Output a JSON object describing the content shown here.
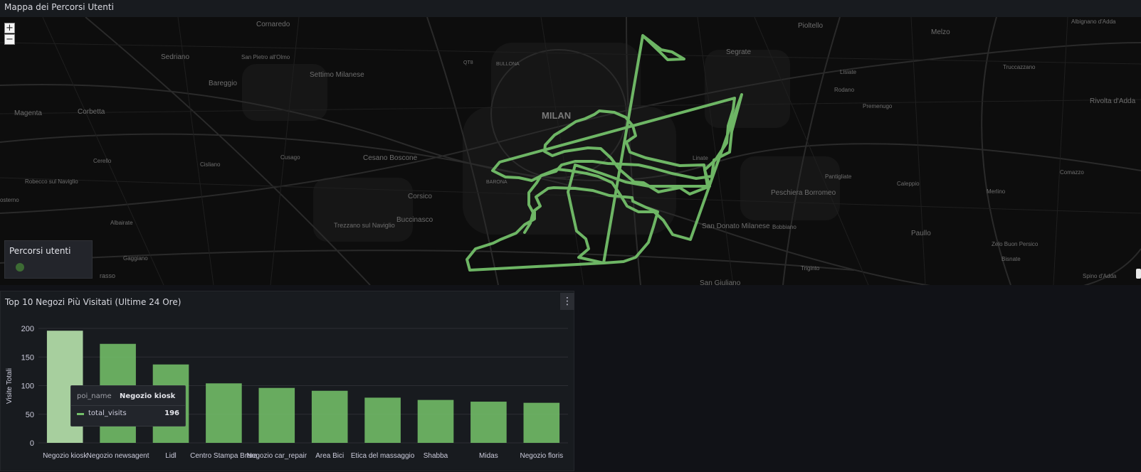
{
  "map_panel": {
    "title": "Mappa dei Percorsi Utenti",
    "zoom_in": "+",
    "zoom_out": "−",
    "legend_title": "Percorsi utenti",
    "route_color": "#73bf69",
    "place_labels": {
      "cornaredo": "Cornaredo",
      "pioltello": "Pioltello",
      "melzo": "Melzo",
      "albignano": "Albignano d'Adda",
      "sedriano": "Sedriano",
      "san_pietro": "San Pietro all'Olmo",
      "settimo": "Settimo Milanese",
      "segrate": "Segrate",
      "bareggio": "Bareggio",
      "bullona": "BULLONA",
      "qt8": "QT8",
      "rodano": "Rodano",
      "truccazzano": "Truccazzano",
      "magenta": "Magenta",
      "corbetta": "Corbetta",
      "milan": "MILAN",
      "pioltello_label": "Pioltello",
      "premenugo": "Premenugo",
      "rivolta": "Rivolta d'Adda",
      "cusago": "Cusago",
      "cesano": "Cesano Boscone",
      "cisliano": "Cisliano",
      "cerello": "Cerello",
      "robecco": "Robecco sul Naviglio",
      "corsico": "Corsico",
      "buccinasco": "Buccinasco",
      "albairate": "Albairate",
      "trezzano": "Trezzano sul Naviglio",
      "gaggiano": "Gaggiano",
      "pantigliate": "Pantigliate",
      "caleppio": "Caleppio",
      "peschiera": "Peschiera Borromeo",
      "merlino": "Merlino",
      "comazzo": "Comazzo",
      "bobbiano": "Bobbiano",
      "paullo": "Paullo",
      "zelo": "Zelo Buon Persico",
      "san_donato": "San Donato Milanese",
      "san_giuliano": "San Giuliano",
      "triginto": "Triginto",
      "bisnate": "Bisnate",
      "spino": "Spino d'Adda",
      "lisiate": "Lisiate",
      "barona": "BARONA",
      "linate": "Linate",
      "osterno": "osterno",
      "grasso": "rasso"
    }
  },
  "chart_panel": {
    "title": "Top 10 Negozi Più Visitati (Ultime 24 Ore)",
    "menu_icon": "⋮",
    "tooltip": {
      "key_label": "poi_name",
      "key_value": "Negozio kiosk",
      "series_label": "total_visits",
      "series_value": "196"
    }
  },
  "chart_data": {
    "type": "bar",
    "title": "Top 10 Negozi Più Visitati (Ultime 24 Ore)",
    "xlabel": "",
    "ylabel": "Visite Totali",
    "categories": [
      "Negozio kiosk",
      "Negozio newsagent",
      "Lidl",
      "Centro Stampa Brera",
      "Negozio car_repair",
      "Area Bici",
      "Etica del massaggio",
      "Shabba",
      "Midas",
      "Negozio florist"
    ],
    "category_labels": [
      "Negozio kiosk",
      "Negozio newsagent",
      "Lidl",
      "Centro Stampa Brera",
      "Negozio car_repair",
      "Area Bici",
      "Etica del massaggio",
      "Shabba",
      "Midas",
      "Negozio floris"
    ],
    "series": [
      {
        "name": "total_visits",
        "values": [
          196,
          173,
          137,
          104,
          96,
          91,
          79,
          75,
          72,
          70
        ]
      }
    ],
    "ylim": [
      0,
      200
    ],
    "yticks": [
      0,
      50,
      100,
      150,
      200
    ],
    "highlighted_index": 0,
    "grid": true,
    "bar_color": "#73bf69",
    "highlight_color": "#a7cf9e"
  }
}
